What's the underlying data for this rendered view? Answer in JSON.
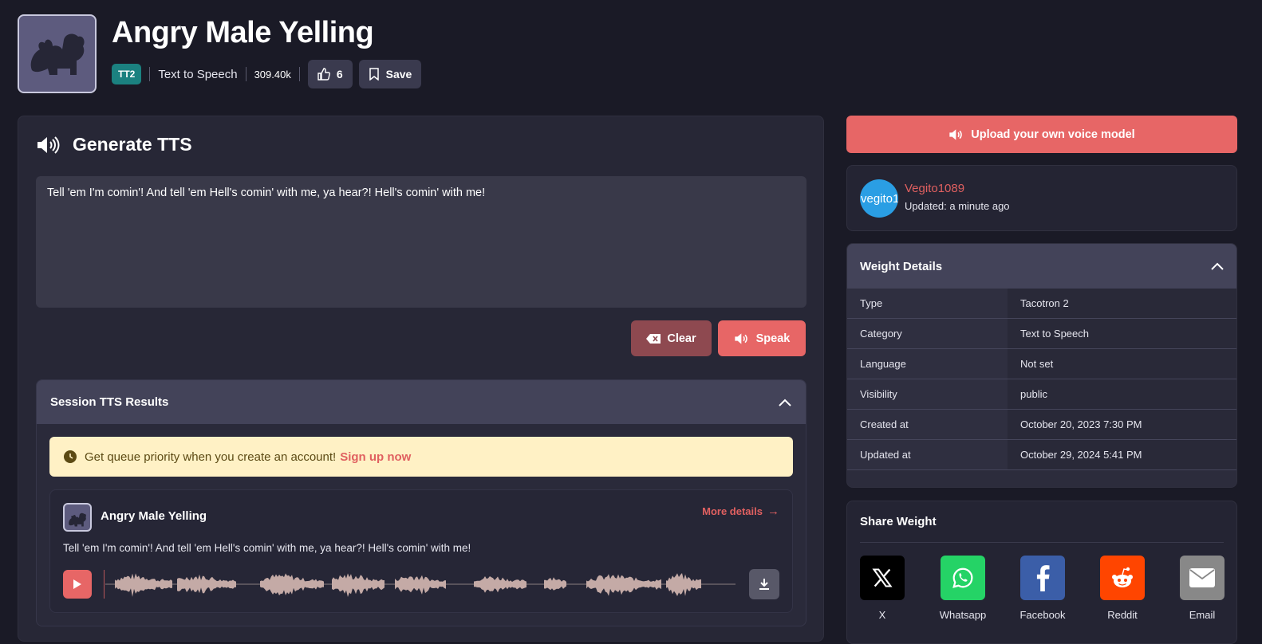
{
  "header": {
    "title": "Angry Male Yelling",
    "badge": "TT2",
    "category": "Text to Speech",
    "uses": "309.40k",
    "likes": "6",
    "save_label": "Save"
  },
  "generate": {
    "title": "Generate TTS",
    "text": "Tell 'em I'm comin'! And tell 'em Hell's comin' with me, ya hear?! Hell's comin' with me!",
    "clear_label": "Clear",
    "speak_label": "Speak"
  },
  "session": {
    "title": "Session TTS Results",
    "notice_text": "Get queue priority when you create an account!",
    "notice_link": "Sign up now",
    "result": {
      "title": "Angry Male Yelling",
      "more_details": "More details",
      "text": "Tell 'em I'm comin'! And tell 'em Hell's comin' with me, ya hear?! Hell's comin' with me!"
    }
  },
  "sidebar": {
    "upload_label": "Upload your own voice model",
    "user": {
      "name": "Vegito1089",
      "avatar_text": "vegito1",
      "updated": "Updated: a minute ago"
    },
    "weight_details": {
      "title": "Weight Details",
      "rows": [
        {
          "key": "Type",
          "value": "Tacotron 2"
        },
        {
          "key": "Category",
          "value": "Text to Speech"
        },
        {
          "key": "Language",
          "value": "Not set"
        },
        {
          "key": "Visibility",
          "value": "public"
        },
        {
          "key": "Created at",
          "value": "October 20, 2023 7:30 PM"
        },
        {
          "key": "Updated at",
          "value": "October 29, 2024 5:41 PM"
        }
      ]
    },
    "share": {
      "title": "Share Weight",
      "items": [
        {
          "label": "X",
          "icon": "x-icon",
          "color": "#000000"
        },
        {
          "label": "Whatsapp",
          "icon": "whatsapp-icon",
          "color": "#25d366"
        },
        {
          "label": "Facebook",
          "icon": "facebook-icon",
          "color": "#3b5ea8"
        },
        {
          "label": "Reddit",
          "icon": "reddit-icon",
          "color": "#ff4500"
        },
        {
          "label": "Email",
          "icon": "email-icon",
          "color": "#888888"
        }
      ]
    }
  },
  "colors": {
    "accent": "#e76666",
    "clear": "#8e4950",
    "badge": "#1b8180",
    "background": "#1a1a26"
  }
}
